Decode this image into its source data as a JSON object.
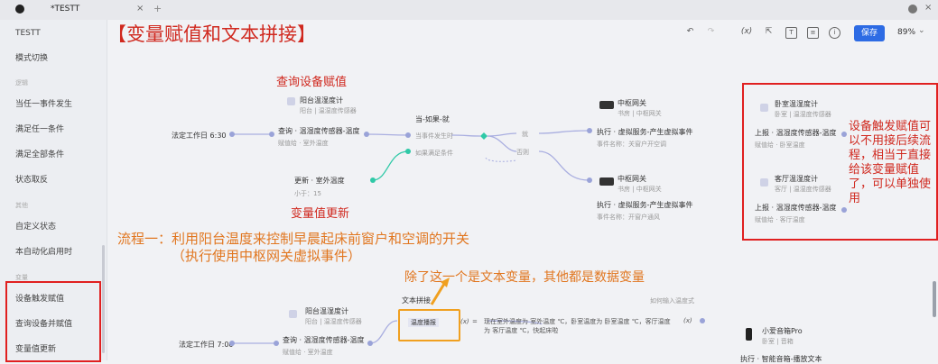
{
  "window": {
    "tab_title": "*TESTT",
    "add_tab": "+",
    "close_tab": "×"
  },
  "sidebar": {
    "title": "TESTT",
    "mode_switch": "模式切换",
    "cat_logic": "逻辑",
    "items_logic": [
      "当任一事件发生",
      "满足任一条件",
      "满足全部条件",
      "状态取反"
    ],
    "cat_other": "其他",
    "items_other": [
      "自定义状态",
      "本自动化启用时"
    ],
    "cat_var": "变量",
    "items_var": [
      "设备触发赋值",
      "查询设备并赋值",
      "变量值更新"
    ]
  },
  "toolbar": {
    "save_label": "保存",
    "zoom": "89%",
    "fx_label": "(x)"
  },
  "annotations": {
    "main_title": "【变量赋值和文本拼接】",
    "query_assign": "查询设备赋值",
    "var_update": "变量值更新",
    "flow_line1": "流程一：利用阳台温度来控制早晨起床前窗户和空调的开关",
    "flow_line2": "（执行使用中枢网关虚拟事件）",
    "text_var_note": "除了这一个是文本变量，其他都是数据变量",
    "device_trigger_note": "设备触发赋值可以不用接后续流程，相当于直接给该变量赋值了，可以单独使用"
  },
  "flow1": {
    "trigger_label": "法定工作日 6:30",
    "query_device_name": "阳台温湿度计",
    "query_device_sub": "阳台 | 温湿度传感器",
    "query_action": "查询 · 温湿度传感器-温度",
    "query_result": "赋值给 · 室外温度",
    "cond_title": "当-如果-就",
    "cond_when": "当事件发生时",
    "cond_if": "如果满足条件",
    "branch_yes": "就",
    "branch_no": "否则",
    "update_action": "更新 · 室外温度",
    "update_sub": "小于：15",
    "hub1_name": "中枢网关",
    "hub1_sub": "书房 | 中枢网关",
    "hub1_action": "执行 · 虚拟服务-产生虚拟事件",
    "hub1_event": "事件名称：关窗户开空调",
    "hub2_name": "中枢网关",
    "hub2_sub": "书房 | 中枢网关",
    "hub2_action": "执行 · 虚拟服务-产生虚拟事件",
    "hub2_event": "事件名称：开窗户通风"
  },
  "trigger_panel": {
    "dev1_name": "卧室温湿度计",
    "dev1_sub": "卧室 | 温湿度传感器",
    "dev1_action": "上报 · 温湿度传感器-温度",
    "dev1_result": "赋值给 · 卧室温度",
    "dev2_name": "客厅温湿度计",
    "dev2_sub": "客厅 | 温湿度传感器",
    "dev2_action": "上报 · 温湿度传感器-温度",
    "dev2_result": "赋值给 · 客厅温度"
  },
  "flow2": {
    "trigger_label": "法定工作日 7:00",
    "query_device_name": "阳台温湿度计",
    "query_device_sub": "阳台 | 温湿度传感器",
    "query_action": "查询 · 温湿度传感器-温度",
    "query_result": "赋值给 · 室外温度",
    "text_concat_title": "文本拼接",
    "text_var_label": "温度播报",
    "fx": "(x)",
    "equals": "=",
    "concat_text": "现在室外温度为 室外温度 ℃，卧室温度为 卧室温度 ℃，客厅温度为 客厅温度 ℃，快起床啦",
    "insert_hint": "如何输入温度式",
    "speaker_name": "小爱音箱Pro",
    "speaker_sub": "卧室 | 音箱",
    "speaker_action": "执行 · 智能音箱-播放文本"
  }
}
